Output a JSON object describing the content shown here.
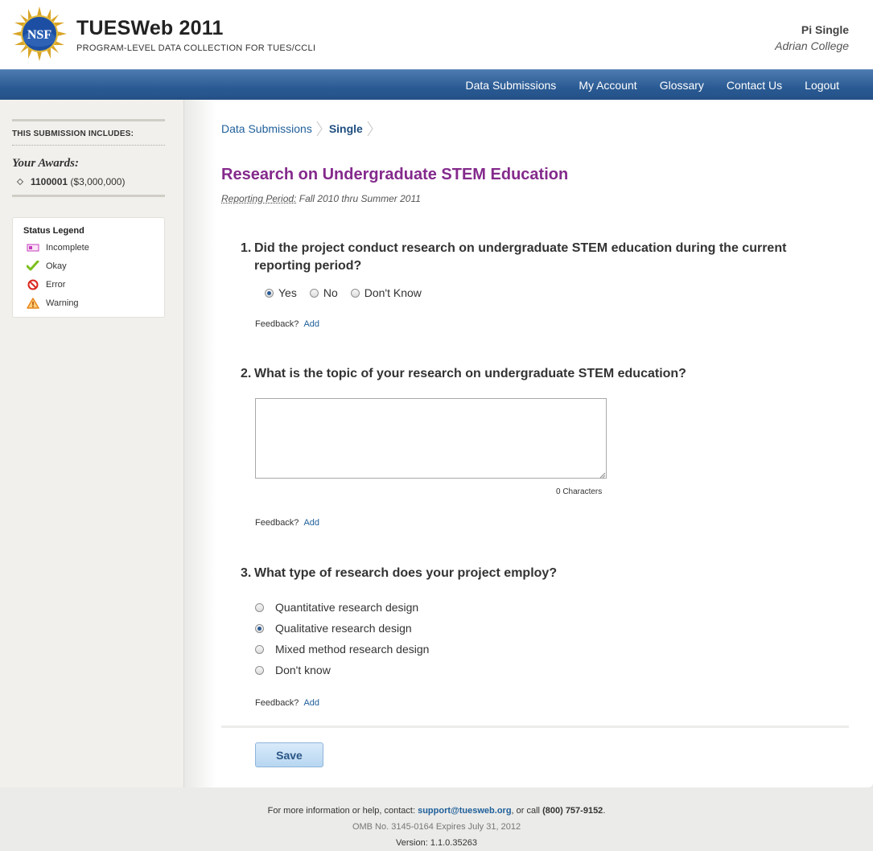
{
  "header": {
    "logo_text": "NSF",
    "title": "TUESWeb 2011",
    "subtitle": "PROGRAM-LEVEL DATA COLLECTION FOR TUES/CCLI",
    "user_name": "Pi Single",
    "user_org": "Adrian College"
  },
  "nav": {
    "items": [
      "Data Submissions",
      "My Account",
      "Glossary",
      "Contact Us",
      "Logout"
    ]
  },
  "sidebar": {
    "heading": "THIS SUBMISSION INCLUDES:",
    "awards_label": "Your Awards:",
    "award_id": "1100001",
    "award_amount": "($3,000,000)",
    "legend": {
      "title": "Status Legend",
      "items": [
        {
          "label": "Incomplete",
          "icon": "incomplete-icon",
          "color": "#c33cbb"
        },
        {
          "label": "Okay",
          "icon": "checkmark-icon",
          "color": "#7cbf1e"
        },
        {
          "label": "Error",
          "icon": "error-icon",
          "color": "#d9251c"
        },
        {
          "label": "Warning",
          "icon": "warning-icon",
          "color": "#e8861a"
        }
      ]
    }
  },
  "breadcrumb": {
    "link": "Data Submissions",
    "current": "Single"
  },
  "page": {
    "title": "Research on Undergraduate STEM Education",
    "period_label": "Reporting Period:",
    "period_value": "Fall 2010 thru Summer 2011"
  },
  "questions": [
    {
      "num": "1.",
      "text": "Did the project conduct research on undergraduate STEM education during the current reporting period?",
      "options": [
        {
          "label": "Yes",
          "checked": true
        },
        {
          "label": "No",
          "checked": false
        },
        {
          "label": "Don't Know",
          "checked": false
        }
      ]
    },
    {
      "num": "2.",
      "text": "What is the topic of your research on undergraduate STEM education?",
      "value": "",
      "char_count": "0 Characters"
    },
    {
      "num": "3.",
      "text": "What type of research does your project employ?",
      "options": [
        {
          "label": "Quantitative research design",
          "checked": false
        },
        {
          "label": "Qualitative research design",
          "checked": true
        },
        {
          "label": "Mixed method research design",
          "checked": false
        },
        {
          "label": "Don't know",
          "checked": false
        }
      ]
    }
  ],
  "feedback": {
    "label": "Feedback?",
    "add": "Add"
  },
  "save_label": "Save",
  "footer": {
    "contact_prefix": "For more information or help, contact:",
    "email": "support@tuesweb.org",
    "contact_mid": ", or call",
    "phone": "(800) 757-9152",
    "contact_suffix": ".",
    "omb": "OMB No. 3145-0164 Expires July 31, 2012",
    "version": "Version: 1.1.0.35263"
  },
  "colors": {
    "nav_blue": "#2a5a93",
    "title_purple": "#842a8c",
    "link_blue": "#1f5f9a"
  }
}
